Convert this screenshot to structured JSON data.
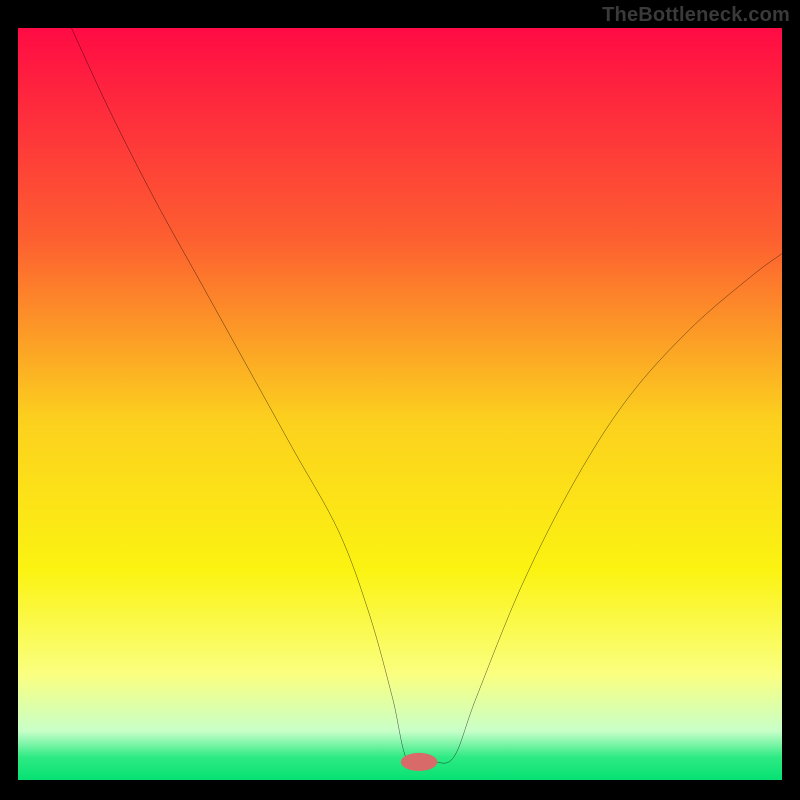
{
  "watermark": "TheBottleneck.com",
  "chart_data": {
    "type": "line",
    "title": "",
    "xlabel": "",
    "ylabel": "",
    "xlim": [
      0,
      100
    ],
    "ylim": [
      0,
      100
    ],
    "grid": false,
    "legend": false,
    "background_gradient": {
      "stops": [
        {
          "offset": 0.0,
          "color": "#ff0b44"
        },
        {
          "offset": 0.28,
          "color": "#fd5f30"
        },
        {
          "offset": 0.52,
          "color": "#fcd01e"
        },
        {
          "offset": 0.72,
          "color": "#fbf311"
        },
        {
          "offset": 0.86,
          "color": "#faff80"
        },
        {
          "offset": 0.935,
          "color": "#c8ffc8"
        },
        {
          "offset": 0.97,
          "color": "#2dea84"
        },
        {
          "offset": 1.0,
          "color": "#06e173"
        }
      ]
    },
    "series": [
      {
        "name": "bottleneck-curve",
        "color": "#000000",
        "x": [
          7,
          12,
          18,
          24,
          30,
          36,
          42,
          46,
          49,
          51,
          54,
          57,
          60,
          66,
          73,
          80,
          88,
          96,
          100
        ],
        "values": [
          100,
          89,
          77,
          66,
          55,
          44,
          33,
          22,
          11,
          2.5,
          2.5,
          3,
          11,
          26,
          40,
          51,
          60,
          67,
          70
        ]
      }
    ],
    "marker": {
      "name": "optimum-marker",
      "color": "#d86a6a",
      "x": 52.5,
      "y": 2.4,
      "rx": 2.4,
      "ry": 1.2
    }
  }
}
